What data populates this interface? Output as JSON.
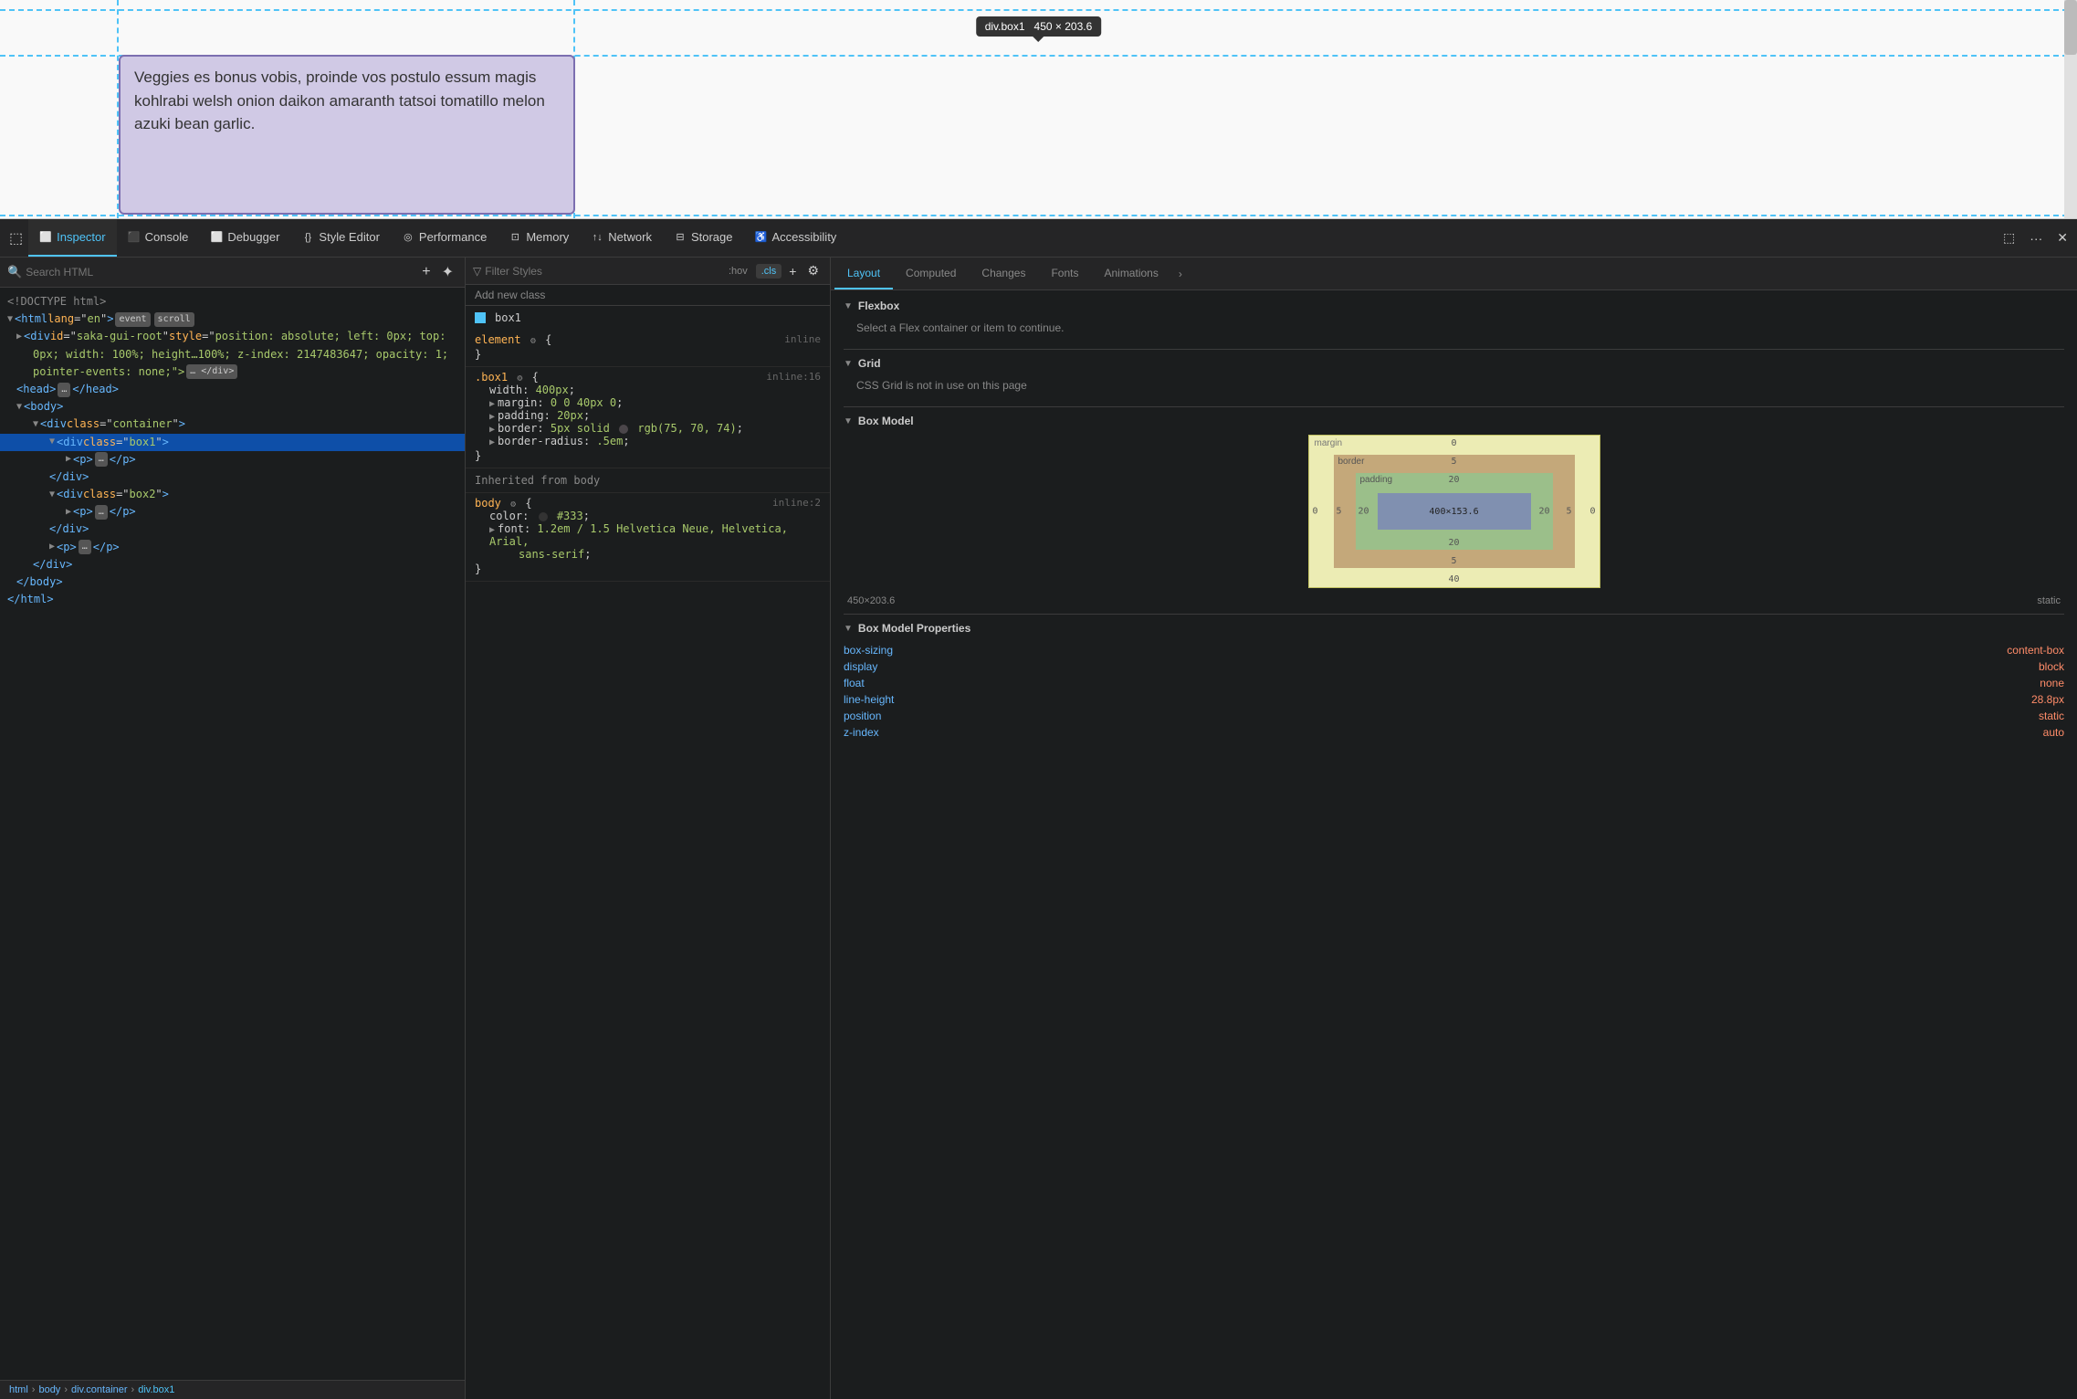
{
  "viewport": {
    "tooltip": {
      "text": "div.box1",
      "dimensions": "450 × 203.6"
    },
    "content_text": "Veggies es bonus vobis, proinde vos postulo essum magis kohlrabi welsh onion daikon amaranth tatsoi tomatillo melon azuki bean garlic."
  },
  "devtools": {
    "tabs": [
      {
        "id": "inspector",
        "label": "Inspector",
        "icon": "⬜",
        "active": true
      },
      {
        "id": "console",
        "label": "Console",
        "icon": "⬛",
        "active": false
      },
      {
        "id": "debugger",
        "label": "Debugger",
        "icon": "⬜",
        "active": false
      },
      {
        "id": "style-editor",
        "label": "Style Editor",
        "icon": "{}",
        "active": false
      },
      {
        "id": "performance",
        "label": "Performance",
        "icon": "◎",
        "active": false
      },
      {
        "id": "memory",
        "label": "Memory",
        "icon": "⊡",
        "active": false
      },
      {
        "id": "network",
        "label": "Network",
        "icon": "↑↓",
        "active": false
      },
      {
        "id": "storage",
        "label": "Storage",
        "icon": "⊟",
        "active": false
      },
      {
        "id": "accessibility",
        "label": "Accessibility",
        "icon": "♿",
        "active": false
      }
    ]
  },
  "html_panel": {
    "search_placeholder": "Search HTML",
    "html_lines": [
      {
        "id": "doctype",
        "text": "<!DOCTYPE html>",
        "indent": 0
      },
      {
        "id": "html-tag",
        "text": "<html lang=\"en\">",
        "indent": 0
      },
      {
        "id": "saka-div",
        "text": "<div id=\"saka-gui-root\" style=\"position: absolute; left: 0px; top: 0px; width: 100%; height…100%; z-index: 2147483647; opacity: 1; pointer-events: none;\">",
        "indent": 1
      },
      {
        "id": "head-tag",
        "text": "<head>…</head>",
        "indent": 1
      },
      {
        "id": "body-open",
        "text": "<body>",
        "indent": 1
      },
      {
        "id": "container-div",
        "text": "<div class=\"container\">",
        "indent": 2
      },
      {
        "id": "box1-div",
        "text": "<div class=\"box1\">",
        "indent": 3,
        "selected": true
      },
      {
        "id": "p1",
        "text": "<p> … </p>",
        "indent": 4
      },
      {
        "id": "box1-close",
        "text": "</div>",
        "indent": 3
      },
      {
        "id": "box2-div",
        "text": "<div class=\"box2\">",
        "indent": 3
      },
      {
        "id": "p2",
        "text": "<p> … </p>",
        "indent": 4
      },
      {
        "id": "box2-close",
        "text": "</div>",
        "indent": 3
      },
      {
        "id": "p3",
        "text": "<p> … </p>",
        "indent": 3
      },
      {
        "id": "container-close",
        "text": "</div>",
        "indent": 2
      },
      {
        "id": "body-close",
        "text": "</body>",
        "indent": 1
      },
      {
        "id": "html-close",
        "text": "</html>",
        "indent": 0
      }
    ],
    "breadcrumb": [
      "html",
      "body",
      "div.container",
      "div.box1"
    ]
  },
  "css_panel": {
    "filter_placeholder": "Filter Styles",
    "hov_label": ":hov",
    "cls_label": ".cls",
    "add_class_placeholder": "Add new class",
    "selected_element": "box1",
    "rules": [
      {
        "selector": "element",
        "source": "inline",
        "properties": []
      },
      {
        "selector": ".box1",
        "source": "inline:16",
        "properties": [
          {
            "name": "width",
            "value": "400px",
            "has_arrow": false
          },
          {
            "name": "margin",
            "value": "0 0 40px 0",
            "has_arrow": true
          },
          {
            "name": "padding",
            "value": "20px",
            "has_arrow": true
          },
          {
            "name": "border",
            "value": "5px solid",
            "value2": "rgb(75, 70, 74)",
            "has_color": true,
            "color": "#4b464a"
          },
          {
            "name": "border-radius",
            "value": ".5em",
            "has_arrow": true
          }
        ]
      }
    ],
    "inherited_header": "Inherited from body",
    "body_rule": {
      "selector": "body",
      "source": "inline:2",
      "properties": [
        {
          "name": "color",
          "value": "#333",
          "has_color": true,
          "color": "#333"
        },
        {
          "name": "font",
          "value": "1.2em / 1.5 Helvetica Neue, Helvetica, Arial, sans-serif",
          "has_arrow": true
        }
      ]
    }
  },
  "right_panel": {
    "tabs": [
      "Layout",
      "Computed",
      "Changes",
      "Fonts",
      "Animations"
    ],
    "active_tab": "Layout",
    "flexbox": {
      "title": "Flexbox",
      "hint": "Select a Flex container or item to continue."
    },
    "grid": {
      "title": "Grid",
      "hint": "CSS Grid is not in use on this page"
    },
    "box_model": {
      "title": "Box Model",
      "margin_label": "margin",
      "border_label": "border",
      "padding_label": "padding",
      "content_value": "400×153.6",
      "margin_top": "0",
      "margin_right": "0",
      "margin_bottom": "40",
      "margin_left": "0",
      "border_top": "5",
      "border_right": "5",
      "border_bottom": "5",
      "border_left": "5",
      "padding_top": "20",
      "padding_right": "20",
      "padding_bottom": "20",
      "padding_left": "20",
      "size": "450×203.6",
      "position": "static"
    },
    "box_model_props": {
      "title": "Box Model Properties",
      "properties": [
        {
          "name": "box-sizing",
          "value": "content-box"
        },
        {
          "name": "display",
          "value": "block"
        },
        {
          "name": "float",
          "value": "none"
        },
        {
          "name": "line-height",
          "value": "28.8px"
        },
        {
          "name": "position",
          "value": "static"
        },
        {
          "name": "z-index",
          "value": "auto"
        }
      ]
    }
  }
}
